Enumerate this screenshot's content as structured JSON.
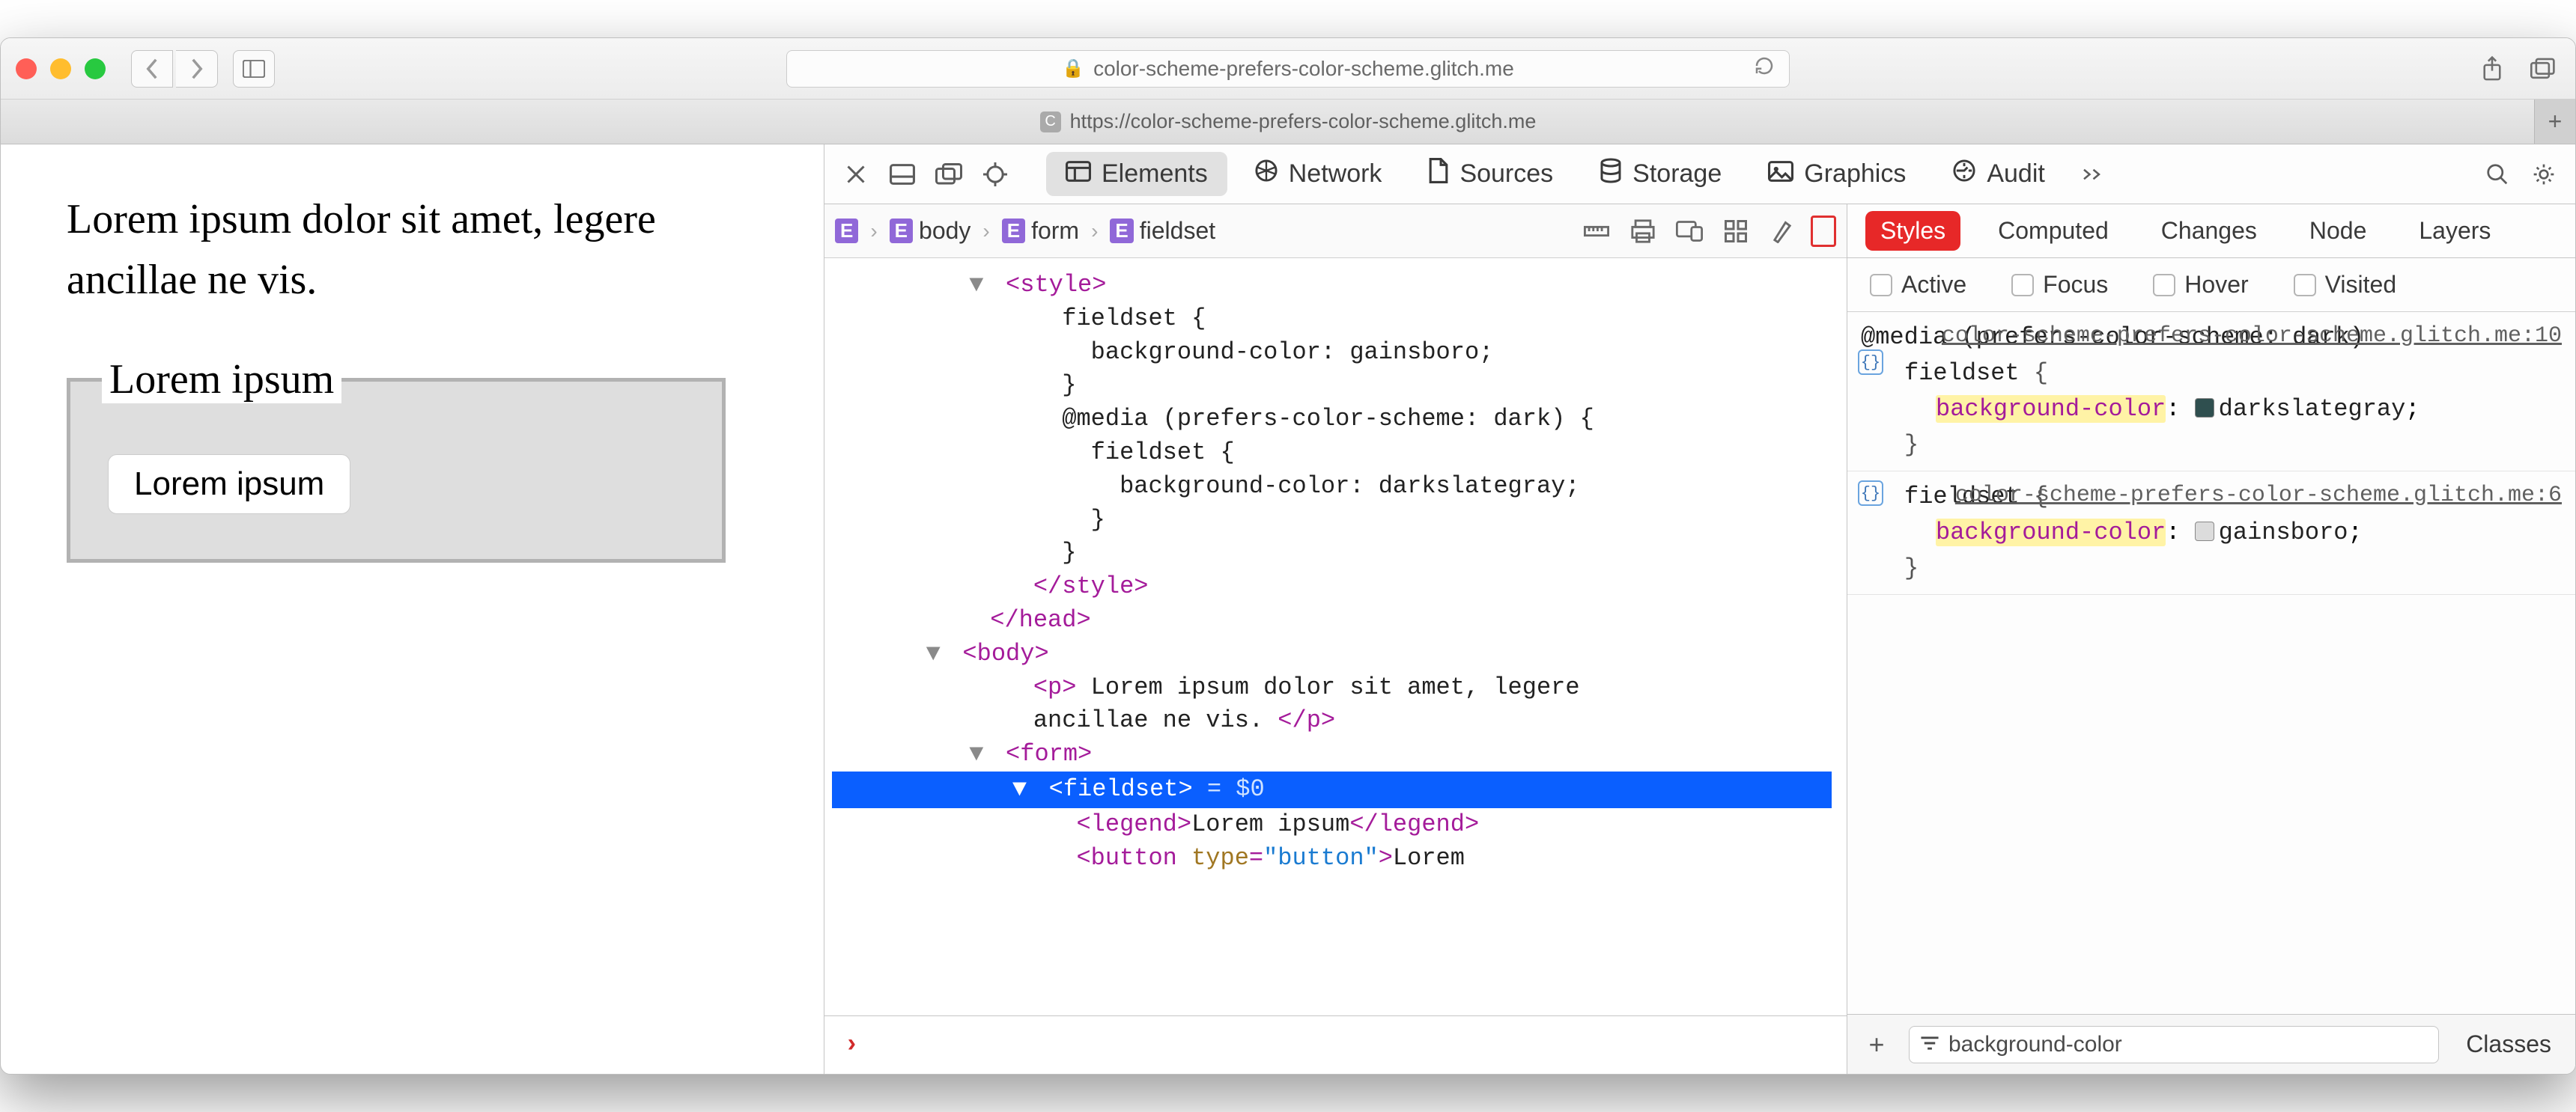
{
  "titlebar": {
    "url_display": "color-scheme-prefers-color-scheme.glitch.me",
    "tab_label": "https://color-scheme-prefers-color-scheme.glitch.me",
    "tab_favicon_letter": "C"
  },
  "page": {
    "paragraph": "Lorem ipsum dolor sit amet, legere ancillae ne vis.",
    "legend": "Lorem ipsum",
    "button": "Lorem ipsum"
  },
  "devtools": {
    "close": "×",
    "tabs": {
      "elements": "Elements",
      "network": "Network",
      "sources": "Sources",
      "storage": "Storage",
      "graphics": "Graphics",
      "audit": "Audit"
    },
    "breadcrumb": [
      "body",
      "form",
      "fieldset"
    ],
    "source": {
      "style_open": "<style>",
      "css1": "fieldset {",
      "css2": "  background-color: gainsboro;",
      "css3": "}",
      "css4": "@media (prefers-color-scheme: dark) {",
      "css5": "  fieldset {",
      "css6": "    background-color: darkslategray;",
      "css7": "  }",
      "css8": "}",
      "style_close": "</style>",
      "head_close": "</head>",
      "body_open": "<body>",
      "p_open": "<p>",
      "p_text": " Lorem ipsum dolor sit amet, legere",
      "p_text2": "ancillae ne vis. ",
      "p_close": "</p>",
      "form_open": "<form>",
      "fieldset_open": "<fieldset>",
      "eq0": " = $0",
      "legend_open": "<legend>",
      "legend_text": "Lorem ipsum",
      "legend_close": "</legend>",
      "button_open": "<button ",
      "button_attr_n": "type",
      "button_attr_v": "\"button\"",
      "button_gt": ">",
      "button_text": "Lorem"
    }
  },
  "sidebar": {
    "tabs": {
      "styles": "Styles",
      "computed": "Computed",
      "changes": "Changes",
      "node": "Node",
      "layers": "Layers"
    },
    "states": {
      "active": "Active",
      "focus": "Focus",
      "hover": "Hover",
      "visited": "Visited"
    },
    "rule1": {
      "media": "@media (prefers-color-scheme: dark)",
      "link": "color-scheme-prefers-color-scheme.glitch.me:10",
      "selector": "fieldset",
      "brace_open": " {",
      "prop": "background-color",
      "colon": ": ",
      "swatch": "#2f4f4f",
      "value": "darkslategray",
      "semi": ";",
      "brace_close": "}"
    },
    "rule2": {
      "link": "color-scheme-prefers-color-scheme.glitch.me:6",
      "selector": "fieldset",
      "brace_open": " {",
      "prop": "background-color",
      "colon": ": ",
      "swatch": "#dcdcdc",
      "value": "gainsboro",
      "semi": ";",
      "brace_close": "}"
    },
    "filter_value": "background-color",
    "classes": "Classes"
  }
}
